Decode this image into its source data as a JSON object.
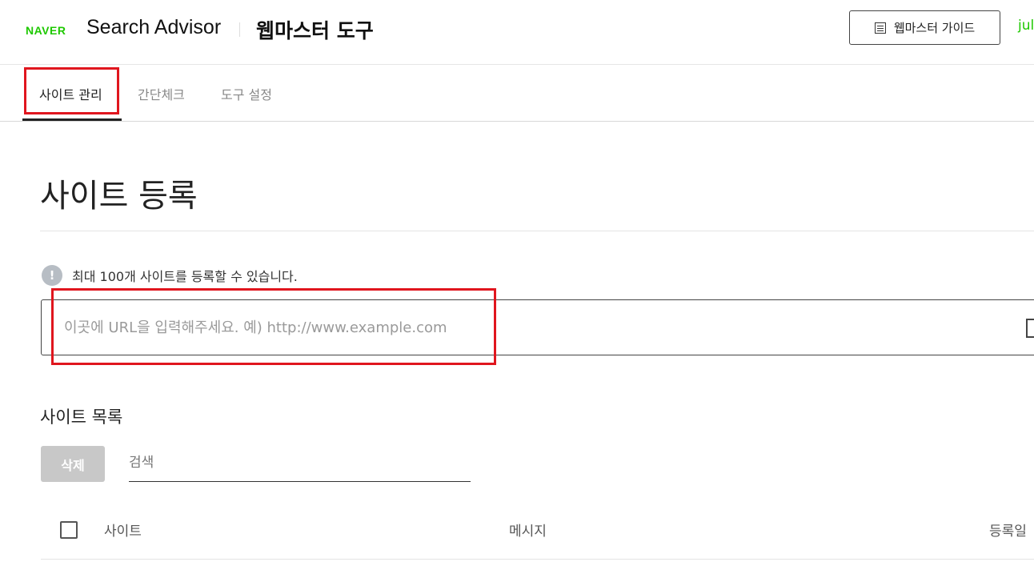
{
  "header": {
    "logo_text": "NAVER",
    "product_name": "Search Advisor",
    "product_sub": "웹마스터 도구",
    "guide_button_label": "웹마스터 가이드",
    "user_text": "jul"
  },
  "tabs": [
    {
      "label": "사이트 관리",
      "active": true
    },
    {
      "label": "간단체크",
      "active": false
    },
    {
      "label": "도구 설정",
      "active": false
    }
  ],
  "register": {
    "title": "사이트 등록",
    "info_icon_text": "!",
    "info_text": "최대 100개 사이트를 등록할 수 있습니다.",
    "url_value": "",
    "url_placeholder": "이곳에 URL을 입력해주세요. 예) http://www.example.com"
  },
  "site_list": {
    "title": "사이트 목록",
    "delete_label": "삭제",
    "search_value": "",
    "search_placeholder": "검색",
    "columns": [
      "사이트",
      "메시지",
      "등록일"
    ]
  },
  "colors": {
    "naver_green": "#1ec800",
    "highlight_red": "#e0161e",
    "disabled_gray": "#c8c8c8"
  }
}
